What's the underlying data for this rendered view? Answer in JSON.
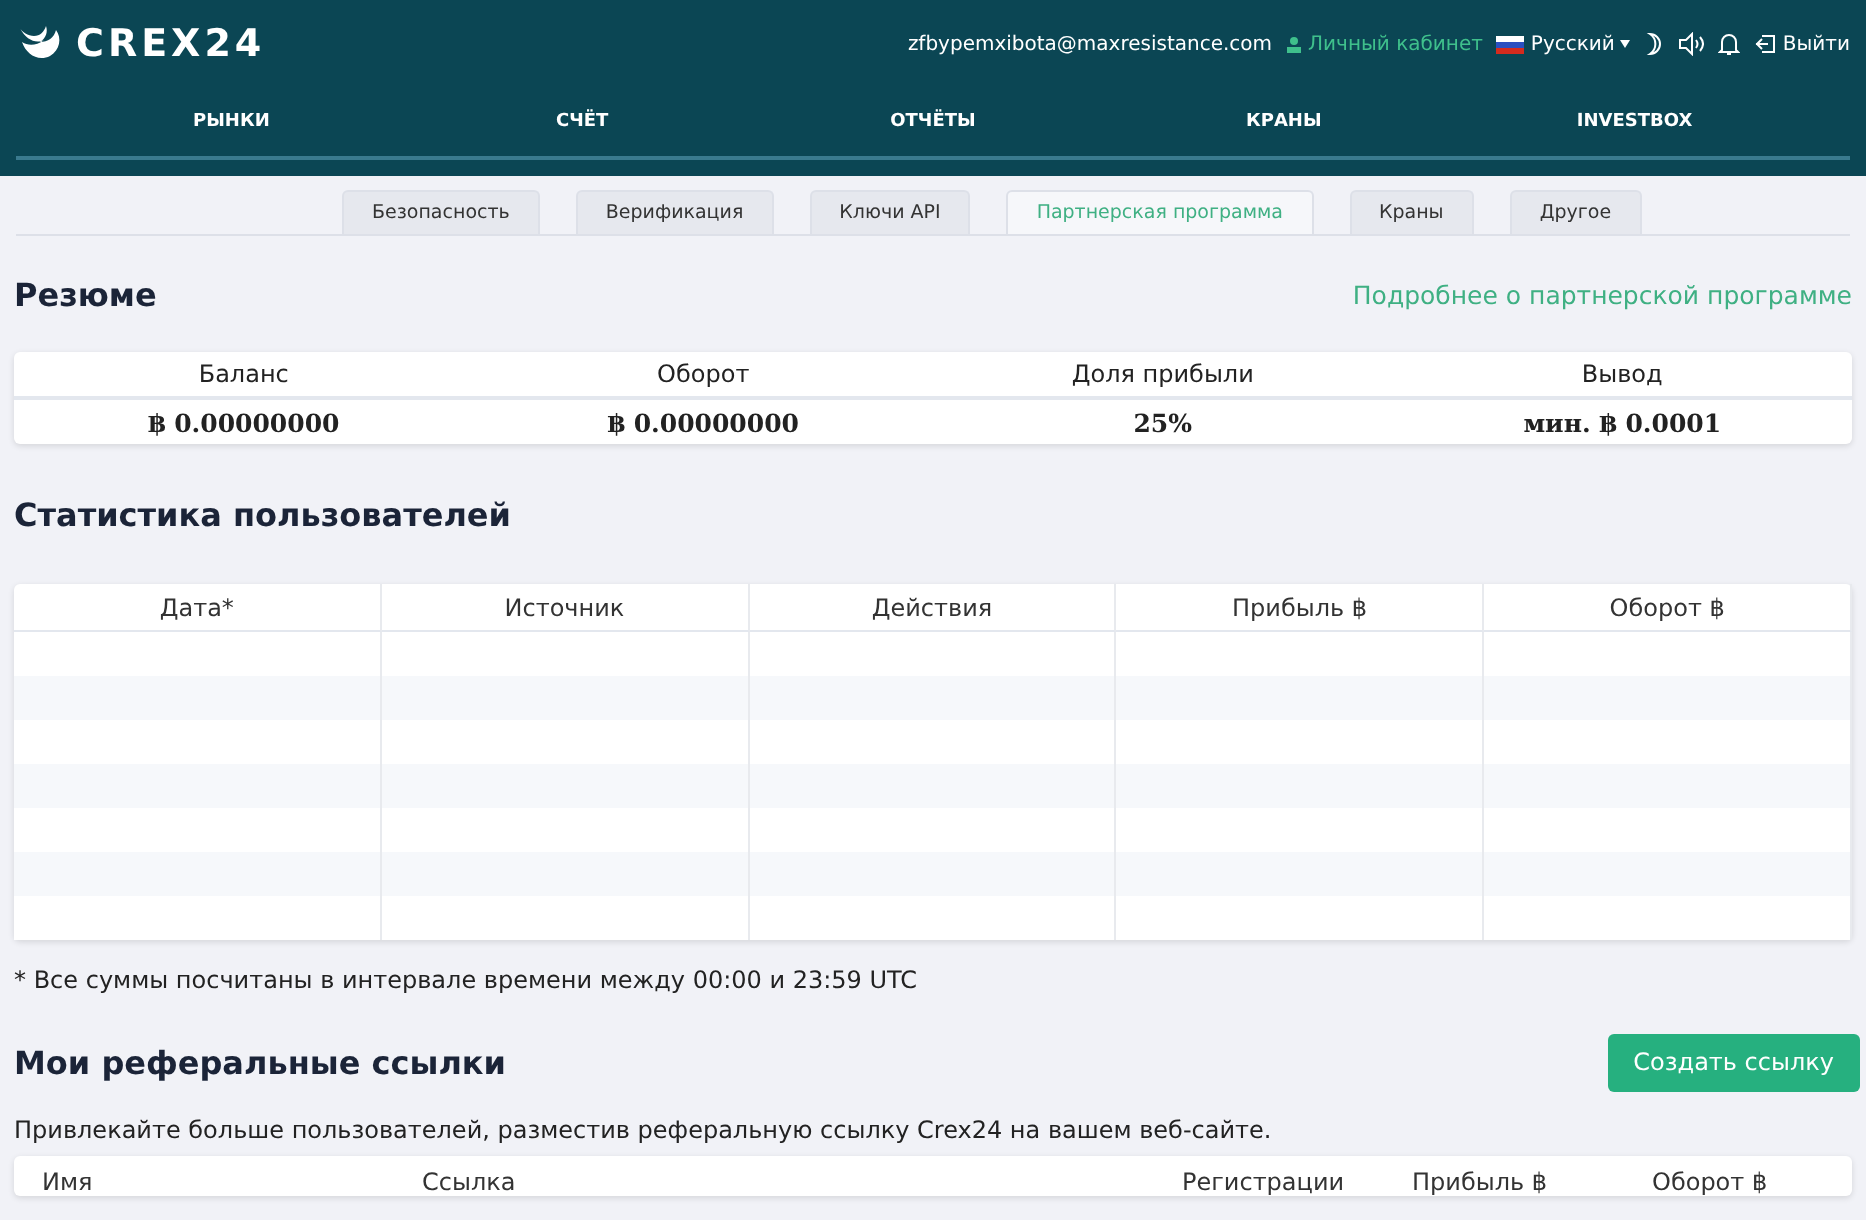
{
  "header": {
    "logo": "CREX24",
    "email": "zfbypemxibota@maxresistance.com",
    "account_link": "Личный кабинет",
    "language": "Русский",
    "logout": "Выйти"
  },
  "nav": [
    {
      "label": "РЫНКИ"
    },
    {
      "label": "СЧЁТ"
    },
    {
      "label": "ОТЧЁТЫ"
    },
    {
      "label": "КРАНЫ"
    },
    {
      "label": "INVESTBOX"
    }
  ],
  "tabs": [
    {
      "label": "Безопасность",
      "selected": false
    },
    {
      "label": "Верификация",
      "selected": false
    },
    {
      "label": "Ключи API",
      "selected": false
    },
    {
      "label": "Партнерская программа",
      "selected": true
    },
    {
      "label": "Краны",
      "selected": false
    },
    {
      "label": "Другое",
      "selected": false
    }
  ],
  "summary": {
    "title": "Резюме",
    "more_link": "Подробнее о партнерской программе",
    "columns": [
      {
        "label": "Баланс",
        "value": "฿ 0.00000000"
      },
      {
        "label": "Оборот",
        "value": "฿ 0.00000000"
      },
      {
        "label": "Доля прибыли",
        "value": "25%"
      },
      {
        "label": "Вывод",
        "value": "мин. ฿ 0.0001"
      }
    ]
  },
  "stats": {
    "title": "Статистика пользователей",
    "columns": [
      "Дата*",
      "Источник",
      "Действия",
      "Прибыль ฿",
      "Оборот ฿"
    ],
    "footnote": "* Все суммы посчитаны в интервале времени между 00:00 и 23:59 UTC"
  },
  "links": {
    "title": "Мои реферальные ссылки",
    "button": "Создать ссылку",
    "description": "Привлекайте больше пользователей, разместив реферальную ссылку Crex24 на вашем веб-сайте.",
    "columns": [
      "Имя",
      "Ссылка",
      "Регистрации",
      "Прибыль ฿",
      "Оборот ฿"
    ]
  }
}
